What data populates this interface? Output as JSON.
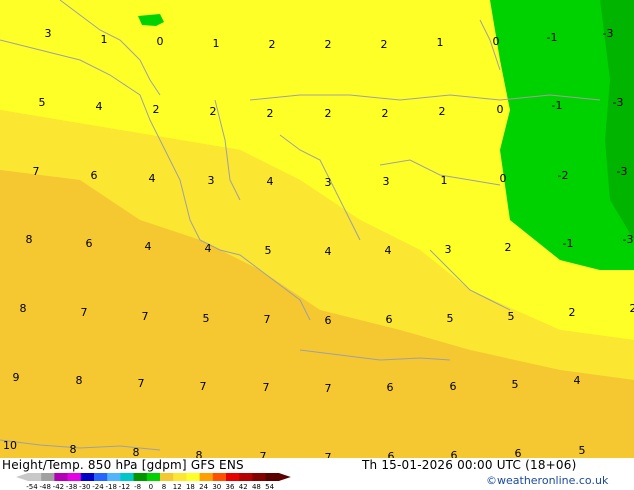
{
  "map": {
    "colors": {
      "background_yellow": "#f7d232",
      "zone_bright_yellow": "#ffff28",
      "zone_yellow": "#fbe632",
      "zone_orange": "#f5c832",
      "zone_green": "#00d200",
      "zone_dark_green": "#00b400",
      "coastline": "#a0a0a0"
    },
    "temperature_labels": [
      {
        "v": "3"
      },
      {
        "v": "1"
      },
      {
        "v": "0"
      },
      {
        "v": "1"
      },
      {
        "v": "2"
      },
      {
        "v": "2"
      },
      {
        "v": "2"
      },
      {
        "v": "1"
      },
      {
        "v": "0"
      },
      {
        "v": "-1"
      },
      {
        "v": "-3"
      },
      {
        "v": "5"
      },
      {
        "v": "4"
      },
      {
        "v": "2"
      },
      {
        "v": "2"
      },
      {
        "v": "2"
      },
      {
        "v": "2"
      },
      {
        "v": "2"
      },
      {
        "v": "2"
      },
      {
        "v": "0"
      },
      {
        "v": "-1"
      },
      {
        "v": "-3"
      },
      {
        "v": "7"
      },
      {
        "v": "6"
      },
      {
        "v": "4"
      },
      {
        "v": "3"
      },
      {
        "v": "4"
      },
      {
        "v": "3"
      },
      {
        "v": "3"
      },
      {
        "v": "1"
      },
      {
        "v": "0"
      },
      {
        "v": "-2"
      },
      {
        "v": "-3"
      },
      {
        "v": "8"
      },
      {
        "v": "6"
      },
      {
        "v": "4"
      },
      {
        "v": "4"
      },
      {
        "v": "5"
      },
      {
        "v": "4"
      },
      {
        "v": "4"
      },
      {
        "v": "3"
      },
      {
        "v": "2"
      },
      {
        "v": "-1"
      },
      {
        "v": "-3"
      },
      {
        "v": "8"
      },
      {
        "v": "7"
      },
      {
        "v": "7"
      },
      {
        "v": "5"
      },
      {
        "v": "7"
      },
      {
        "v": "6"
      },
      {
        "v": "6"
      },
      {
        "v": "5"
      },
      {
        "v": "5"
      },
      {
        "v": "2"
      },
      {
        "v": "2"
      },
      {
        "v": "9"
      },
      {
        "v": "8"
      },
      {
        "v": "7"
      },
      {
        "v": "7"
      },
      {
        "v": "7"
      },
      {
        "v": "7"
      },
      {
        "v": "6"
      },
      {
        "v": "6"
      },
      {
        "v": "5"
      },
      {
        "v": "4"
      },
      {
        "v": "10"
      },
      {
        "v": "8"
      },
      {
        "v": "8"
      },
      {
        "v": "8"
      },
      {
        "v": "7"
      },
      {
        "v": "7"
      },
      {
        "v": "6"
      },
      {
        "v": "6"
      },
      {
        "v": "6"
      },
      {
        "v": "5"
      }
    ]
  },
  "footer": {
    "title_left": "Height/Temp. 850 hPa [gdpm] GFS ENS",
    "title_right": "Th 15-01-2026 00:00 UTC (18+06)",
    "credit": "©weatheronline.co.uk",
    "colorbar": {
      "ticks": [
        "-54",
        "-48",
        "-42",
        "-38",
        "-30",
        "-24",
        "-18",
        "-12",
        "-8",
        "0",
        "8",
        "12",
        "18",
        "24",
        "30",
        "36",
        "42",
        "48",
        "54"
      ],
      "colors": [
        "#c8c8c8",
        "#a0a0a0",
        "#b400b4",
        "#e600e6",
        "#0000c8",
        "#2864ff",
        "#50b4ff",
        "#00c8c8",
        "#009600",
        "#00d200",
        "#f5c832",
        "#fbe632",
        "#ffff28",
        "#ffa000",
        "#ff5000",
        "#e60000",
        "#b40000",
        "#820000",
        "#5a0000"
      ]
    }
  }
}
